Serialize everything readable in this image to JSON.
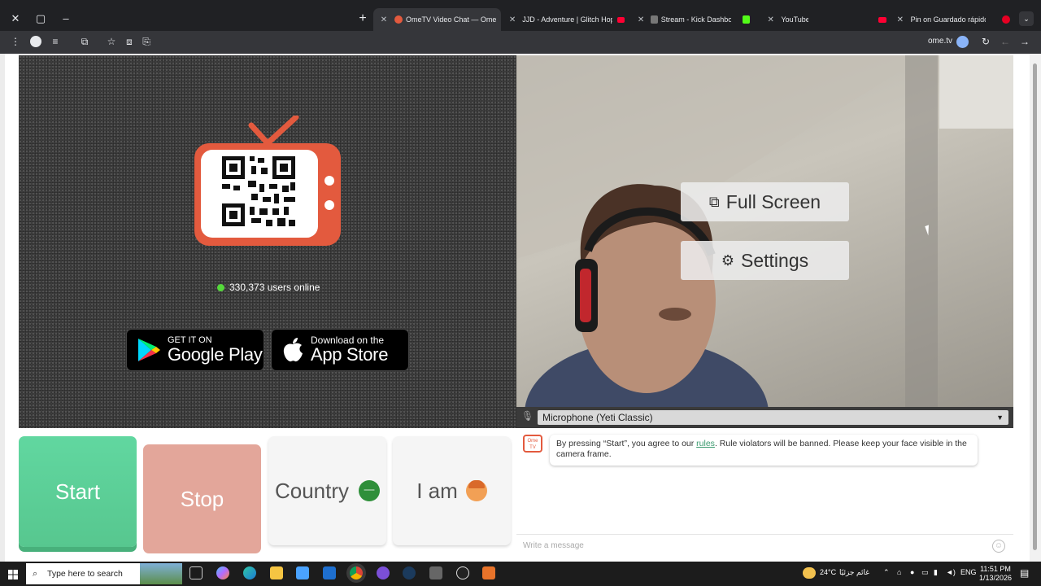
{
  "browser": {
    "tabs": [
      {
        "title": "OmeTV Video Chat — Ome",
        "active": true
      },
      {
        "title": "JJD - Adventure | Glitch Hop | N",
        "active": false
      },
      {
        "title": "Stream - Kick Dashboard",
        "active": false
      },
      {
        "title": "YouTube",
        "active": false
      },
      {
        "title": "Pin on Guardado rápido",
        "active": false
      }
    ],
    "url": "ome.tv"
  },
  "left_panel": {
    "online_count": "330,373 users online",
    "google_play": {
      "small": "GET IT ON",
      "big": "Google Play"
    },
    "app_store": {
      "small": "Download on the",
      "big": "App Store"
    }
  },
  "right_panel": {
    "full_screen_label": "Full Screen",
    "settings_label": "Settings",
    "microphone": "Microphone (Yeti Classic)"
  },
  "controls": {
    "start_label": "Start",
    "stop_label": "Stop",
    "country_label": "Country",
    "iam_label": "I am"
  },
  "chat": {
    "bot_label": "Ome TV",
    "message_pre": "By pressing “Start”, you agree to our ",
    "message_link": "rules",
    "message_post": ". Rule violators will be banned. Please keep your face visible in the camera frame.",
    "input_placeholder": "Write a message"
  },
  "taskbar": {
    "search_placeholder": "Type here to search",
    "weather": "24°C",
    "weather_text": "غائم جزئيًا",
    "language": "ENG",
    "time": "11:51 PM",
    "date": "1/13/2026"
  },
  "colors": {
    "start": "#5fd39b",
    "stop": "#e3a69a",
    "accent_link": "#3a9a6e",
    "brand": "#e35a3e"
  }
}
